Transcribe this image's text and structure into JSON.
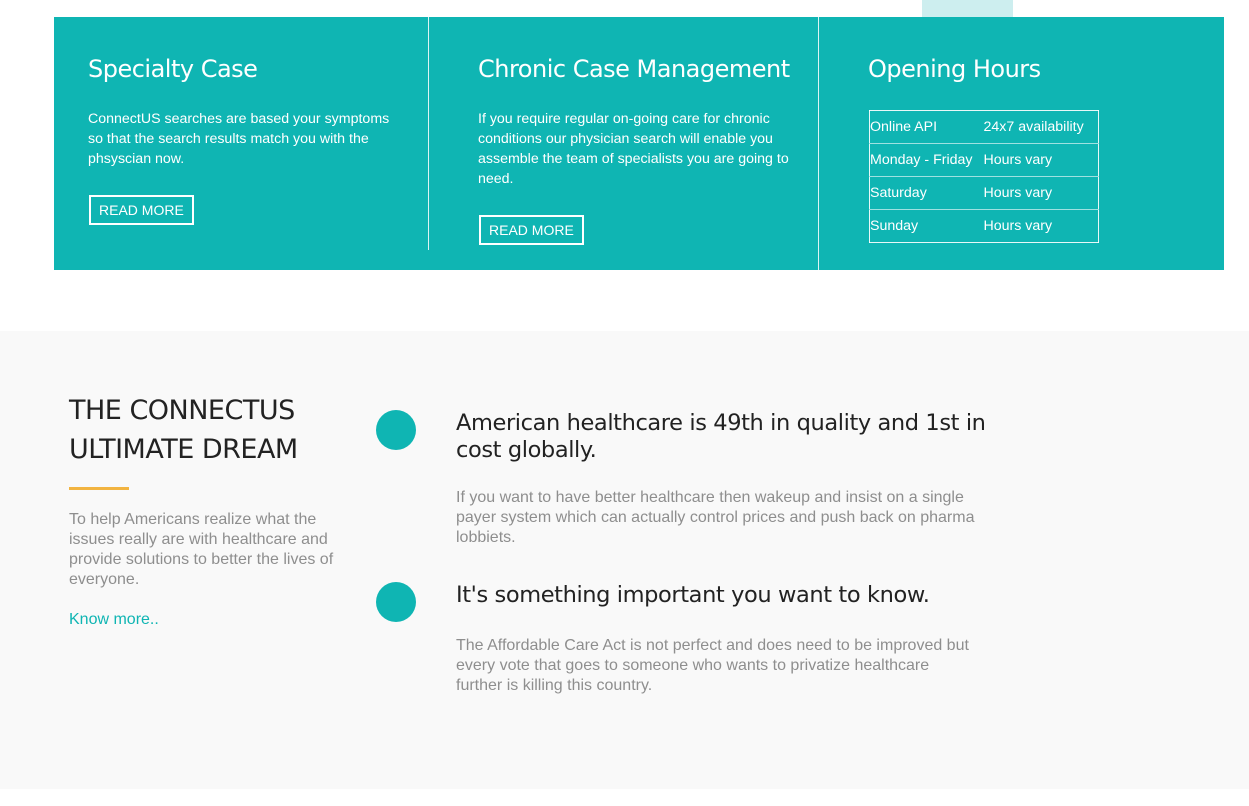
{
  "colors": {
    "teal": "#0fb5b3",
    "accent_light": "#cdeeef",
    "divider_gold": "#f2b441",
    "heading_dark": "#222222",
    "body_gray": "#8e8e8e",
    "section_bg": "#f9f9f9"
  },
  "services": [
    {
      "title": "Specialty Case",
      "text": "ConnectUS searches are based your symptoms so that the search results match you with the phsyscian now.",
      "button_label": "READ MORE"
    },
    {
      "title": "Chronic Case Management",
      "text": "If you require regular on-going care for chronic conditions our physician search will enable you assemble the team of specialists you are going to need.",
      "button_label": "READ MORE"
    }
  ],
  "opening_hours": {
    "title": "Opening Hours",
    "rows": [
      {
        "day": "Online API",
        "hours": "24x7 availability"
      },
      {
        "day": "Monday - Friday",
        "hours": "Hours vary"
      },
      {
        "day": "Saturday",
        "hours": "Hours vary"
      },
      {
        "day": "Sunday",
        "hours": "Hours vary"
      }
    ]
  },
  "dream": {
    "title_line1": "THE CONNECTUS",
    "title_line2": "ULTIMATE DREAM",
    "description": "To help Americans realize what the issues really are with healthcare and provide solutions to better the lives of everyone.",
    "link_label": "Know more.."
  },
  "features": [
    {
      "title": "American healthcare is 49th in quality and 1st in cost globally.",
      "text": "If you want to have better healthcare then wakeup and insist on a single payer system which can actually control prices and push back on pharma lobbiets."
    },
    {
      "title": "It's something important you want to know.",
      "text": "The Affordable Care Act is not perfect and does need to be improved but every vote that goes to someone who wants to privatize healthcare further is killing this country."
    }
  ]
}
